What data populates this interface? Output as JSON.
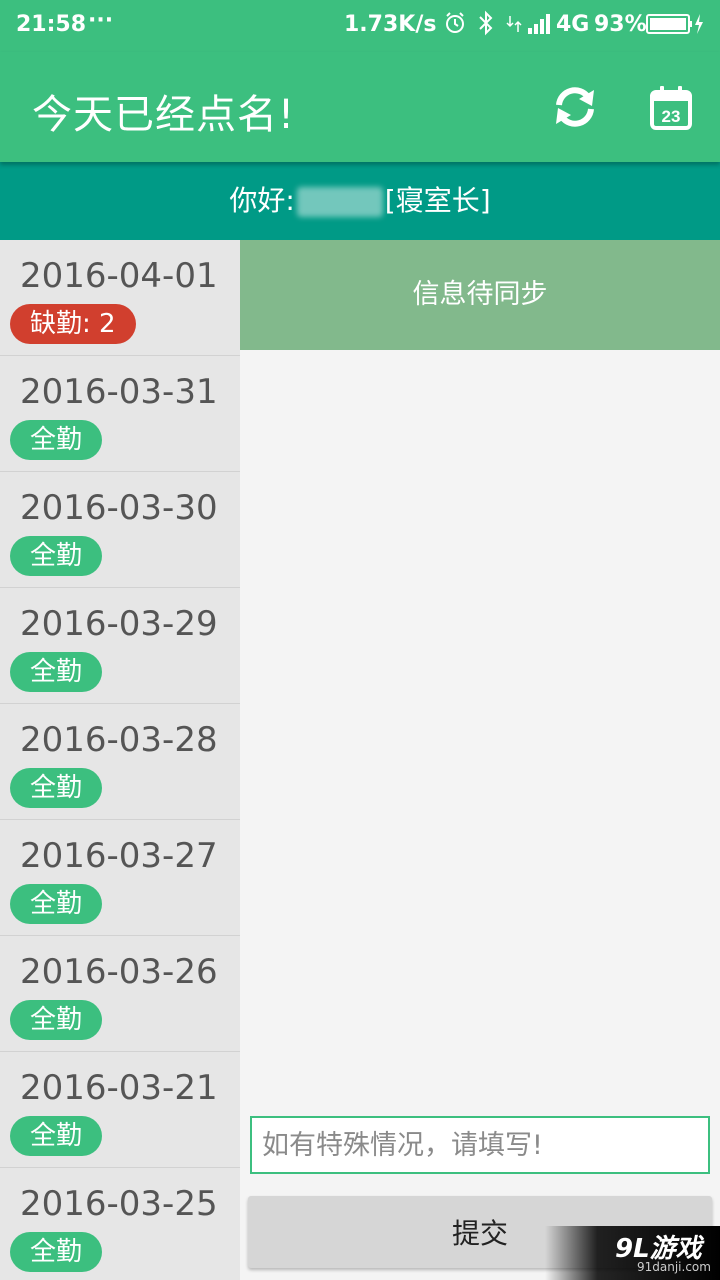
{
  "status_bar": {
    "time": "21:58",
    "more": "···",
    "speed": "1.73K/s",
    "network": "4G",
    "battery": "93%"
  },
  "app_bar": {
    "title": "今天已经点名!",
    "calendar_day": "23"
  },
  "greeting": {
    "prefix": "你好:",
    "role": "[寝室长]"
  },
  "attendance": [
    {
      "date": "2016-04-01",
      "status": "缺勤: 2",
      "color": "#d13f2e"
    },
    {
      "date": "2016-03-31",
      "status": "全勤",
      "color": "#3cbf7f"
    },
    {
      "date": "2016-03-30",
      "status": "全勤",
      "color": "#3cbf7f"
    },
    {
      "date": "2016-03-29",
      "status": "全勤",
      "color": "#3cbf7f"
    },
    {
      "date": "2016-03-28",
      "status": "全勤",
      "color": "#3cbf7f"
    },
    {
      "date": "2016-03-27",
      "status": "全勤",
      "color": "#3cbf7f"
    },
    {
      "date": "2016-03-26",
      "status": "全勤",
      "color": "#3cbf7f"
    },
    {
      "date": "2016-03-21",
      "status": "全勤",
      "color": "#3cbf7f"
    },
    {
      "date": "2016-03-25",
      "status": "全勤",
      "color": "#3cbf7f"
    }
  ],
  "sync_banner": "信息待同步",
  "remark": {
    "placeholder": "如有特殊情况，请填写!",
    "value": ""
  },
  "submit_label": "提交",
  "watermark": {
    "logo": "9L游戏",
    "domain": "91danji.com"
  },
  "colors": {
    "primary": "#3cbf7f",
    "greeting_bg": "#009a86",
    "absent": "#d13f2e",
    "sync_bg": "#82b98c"
  }
}
